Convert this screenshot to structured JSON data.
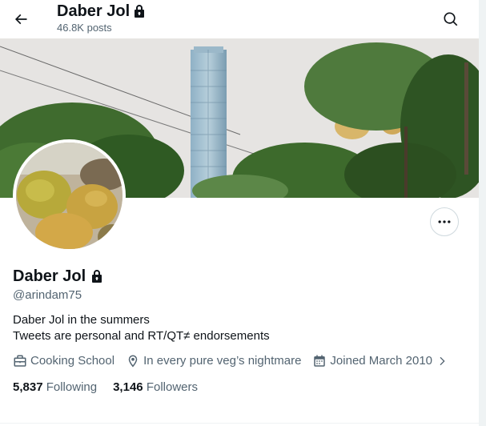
{
  "header": {
    "title": "Daber Jol",
    "posts": "46.8K posts"
  },
  "profile": {
    "name": "Daber Jol",
    "handle": "@arindam75",
    "bio": [
      "Daber Jol in the summers",
      "Tweets are personal and RT/QT≠ endorsements"
    ],
    "category": "Cooking School",
    "location": "In every pure veg’s nightmare",
    "joined": "Joined March 2010"
  },
  "stats": {
    "following_count": "5,837",
    "following_label": "Following",
    "followers_count": "3,146",
    "followers_label": "Followers"
  },
  "icons": {
    "back": "arrow-left-icon",
    "search": "search-icon",
    "lock": "lock-icon",
    "more": "more-horizontal-icon",
    "category": "briefcase-icon",
    "location": "map-pin-icon",
    "joined": "calendar-icon",
    "chevron": "chevron-right-icon"
  },
  "colors": {
    "text": "#0f1419",
    "secondary": "#536471",
    "border": "#cfd9de"
  }
}
